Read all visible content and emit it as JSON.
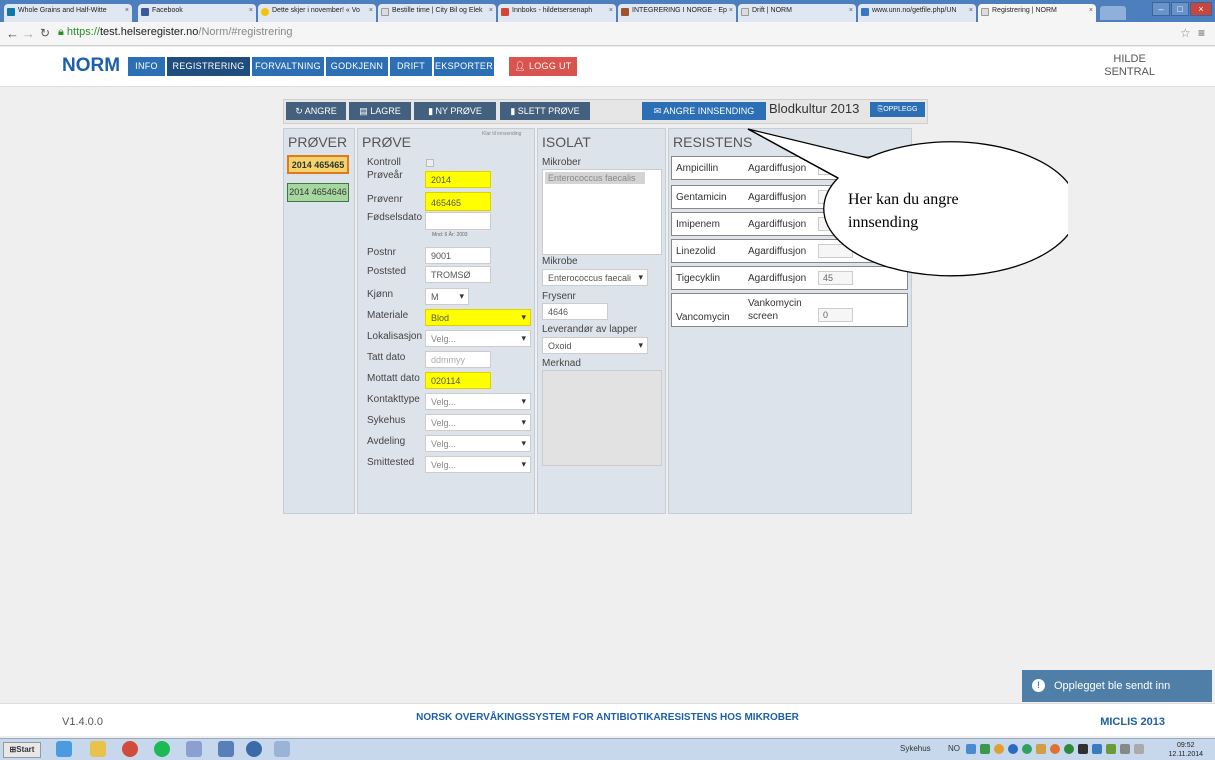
{
  "browser": {
    "tabs": [
      {
        "label": "Whole Grains and Half-Witte",
        "color": "#0e76a8"
      },
      {
        "label": "Facebook",
        "color": "#3b5998"
      },
      {
        "label": "Dette skjer i november! « Vo",
        "color": "#f4c20d"
      },
      {
        "label": "Bestille time | City Bil og Elek",
        "color": "#cccccc"
      },
      {
        "label": "Innboks - hildetsersenaph",
        "color": "#d14836"
      },
      {
        "label": "INTEGRERING I NORGE - Ep",
        "color": "#a0522d"
      },
      {
        "label": "Drift | NORM",
        "color": "#cccccc"
      },
      {
        "label": "www.unn.no/getfile.php/UN",
        "color": "#3a75c4"
      },
      {
        "label": "Registrering | NORM",
        "color": "#cccccc"
      }
    ],
    "url_scheme": "https://",
    "url_host": "test.helseregister.no",
    "url_path": "/Norm/#registrering"
  },
  "header": {
    "brand": "NORM",
    "nav": [
      "INFO",
      "REGISTRERING",
      "FORVALTNING",
      "GODKJENN",
      "DRIFT",
      "EKSPORTER"
    ],
    "logout": "LOGG UT",
    "user_line1": "HILDE",
    "user_line2": "SENTRAL"
  },
  "toolbar": {
    "angre": "ANGRE",
    "lagre": "LAGRE",
    "ny_prove": "NY PRØVE",
    "slett_prove": "SLETT PRØVE",
    "angre_innsending": "ANGRE INNSENDING",
    "title": "Blodkultur 2013",
    "opplegg": "OPPLEGG"
  },
  "prover": {
    "title": "PRØVER",
    "items": [
      "2014 465465",
      "2014 4654646"
    ]
  },
  "prove": {
    "title": "PRØVE",
    "status": "Klar til innsending",
    "fields": {
      "kontroll": "Kontroll",
      "provear": "Prøveår",
      "provear_val": "2014",
      "provenr": "Prøvenr",
      "provenr_val": "465465",
      "fodselsdato": "Fødselsdato",
      "fodsel_hint": "Mnd: 6   År: 2003",
      "postnr": "Postnr",
      "postnr_val": "9001",
      "poststed": "Poststed",
      "poststed_val": "TROMSØ",
      "kjonn": "Kjønn",
      "kjonn_val": "M",
      "materiale": "Materiale",
      "materiale_val": "Blod",
      "lokalisasjon": "Lokalisasjon",
      "velg": "Velg...",
      "tatt_dato": "Tatt dato",
      "tatt_dato_ph": "ddmmyy",
      "mottatt_dato": "Mottatt dato",
      "mottatt_dato_val": "020114",
      "kontakttype": "Kontakttype",
      "sykehus": "Sykehus",
      "avdeling": "Avdeling",
      "smittested": "Smittested"
    }
  },
  "isolat": {
    "title": "ISOLAT",
    "mikrober": "Mikrober",
    "mikrober_val": "Enterococcus faecalis",
    "mikrobe": "Mikrobe",
    "mikrobe_val": "Enterococcus faecali",
    "frysenr": "Frysenr",
    "frysenr_val": "4646",
    "leverandor": "Leverandør av lapper",
    "leverandor_val": "Oxoid",
    "merknad": "Merknad"
  },
  "resistens": {
    "title": "RESISTENS",
    "rows": [
      {
        "name": "Ampicillin",
        "method": "Agardiffusjon",
        "value": ""
      },
      {
        "name": "Gentamicin",
        "method": "Agardiffusjon",
        "value": ""
      },
      {
        "name": "Imipenem",
        "method": "Agardiffusjon",
        "value": ""
      },
      {
        "name": "Linezolid",
        "method": "Agardiffusjon",
        "value": ""
      },
      {
        "name": "Tigecyklin",
        "method": "Agardiffusjon",
        "value": "45"
      },
      {
        "name": "Vancomycin",
        "method": "Vankomycin screen",
        "value": "0"
      }
    ]
  },
  "callout": {
    "line1": "Her kan du angre",
    "line2": "innsending"
  },
  "footer": {
    "version": "V1.4.0.0",
    "title": "NORSK OVERVÅKINGSSYSTEM FOR ANTIBIOTIKARESISTENS HOS MIKROBER",
    "micl": "MICLIS 2013"
  },
  "toast": "Opplegget ble sendt inn",
  "taskbar": {
    "start": "Start",
    "sykehus": "Sykehus",
    "lang": "NO",
    "time": "09:52",
    "date": "12.11.2014"
  }
}
